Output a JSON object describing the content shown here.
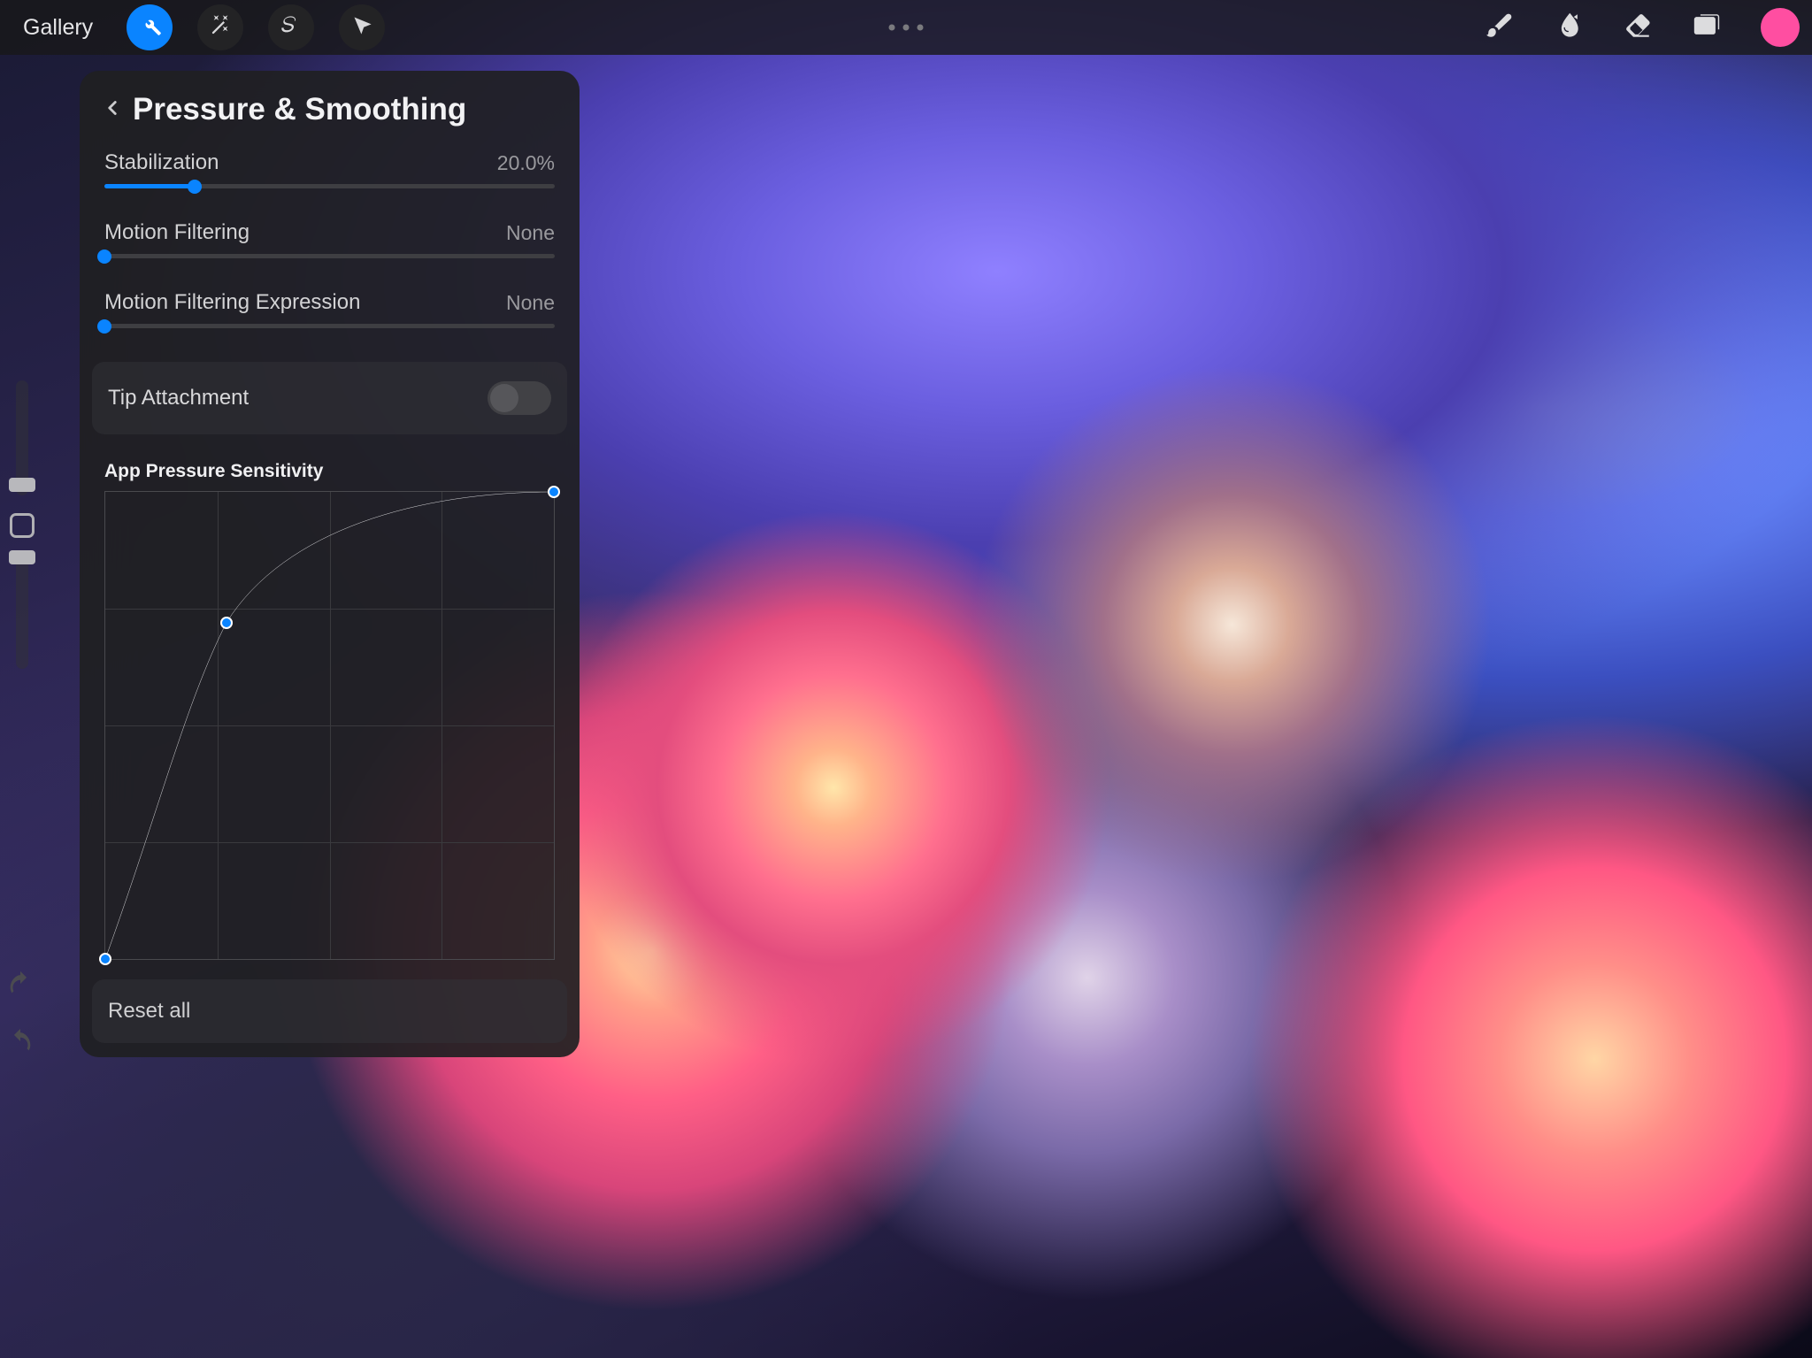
{
  "toolbar": {
    "gallery": "Gallery",
    "color": "#ff4ea1"
  },
  "popover": {
    "title": "Pressure & Smoothing",
    "sliders": [
      {
        "label": "Stabilization",
        "value_text": "20.0%",
        "value": 20.0
      },
      {
        "label": "Motion Filtering",
        "value_text": "None",
        "value": 0
      },
      {
        "label": "Motion Filtering Expression",
        "value_text": "None",
        "value": 0
      }
    ],
    "toggle": {
      "label": "Tip Attachment",
      "on": false
    },
    "curve_title": "App Pressure Sensitivity",
    "curve_points": [
      {
        "x": 0.0,
        "y": 0.0
      },
      {
        "x": 0.27,
        "y": 0.72
      },
      {
        "x": 1.0,
        "y": 1.0
      }
    ],
    "reset": "Reset all"
  }
}
